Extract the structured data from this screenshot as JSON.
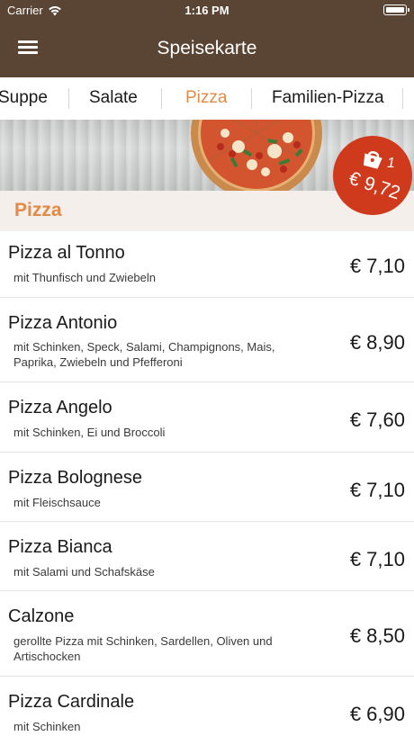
{
  "status_bar": {
    "carrier": "Carrier",
    "time": "1:16 PM"
  },
  "nav": {
    "title": "Speisekarte"
  },
  "tabs": [
    {
      "label": "Suppe"
    },
    {
      "label": "Salate"
    },
    {
      "label": "Pizza",
      "active": true
    },
    {
      "label": "Familien-Pizza"
    }
  ],
  "section": {
    "title": "Pizza"
  },
  "cart": {
    "count": "1",
    "total": "€ 9,72"
  },
  "items": [
    {
      "name": "Pizza al Tonno",
      "desc": "mit Thunfisch und Zwiebeln",
      "price": "€ 7,10"
    },
    {
      "name": "Pizza Antonio",
      "desc": "mit Schinken, Speck, Salami, Champignons, Mais, Paprika, Zwiebeln und Pfefferoni",
      "price": "€ 8,90"
    },
    {
      "name": "Pizza Angelo",
      "desc": "mit Schinken, Ei und Broccoli",
      "price": "€ 7,60"
    },
    {
      "name": "Pizza Bolognese",
      "desc": "mit Fleischsauce",
      "price": "€ 7,10"
    },
    {
      "name": "Pizza Bianca",
      "desc": "mit Salami und Schafskäse",
      "price": "€ 7,10"
    },
    {
      "name": "Calzone",
      "desc": "gerollte Pizza mit Schinken, Sardellen, Oliven und Artischocken",
      "price": "€ 8,50"
    },
    {
      "name": "Pizza Cardinale",
      "desc": "mit Schinken",
      "price": "€ 6,90"
    }
  ],
  "colors": {
    "nav_bg": "#5a4433",
    "accent": "#e28b48",
    "cart_bg": "#d03a1c",
    "section_bg": "#f4efeb"
  }
}
